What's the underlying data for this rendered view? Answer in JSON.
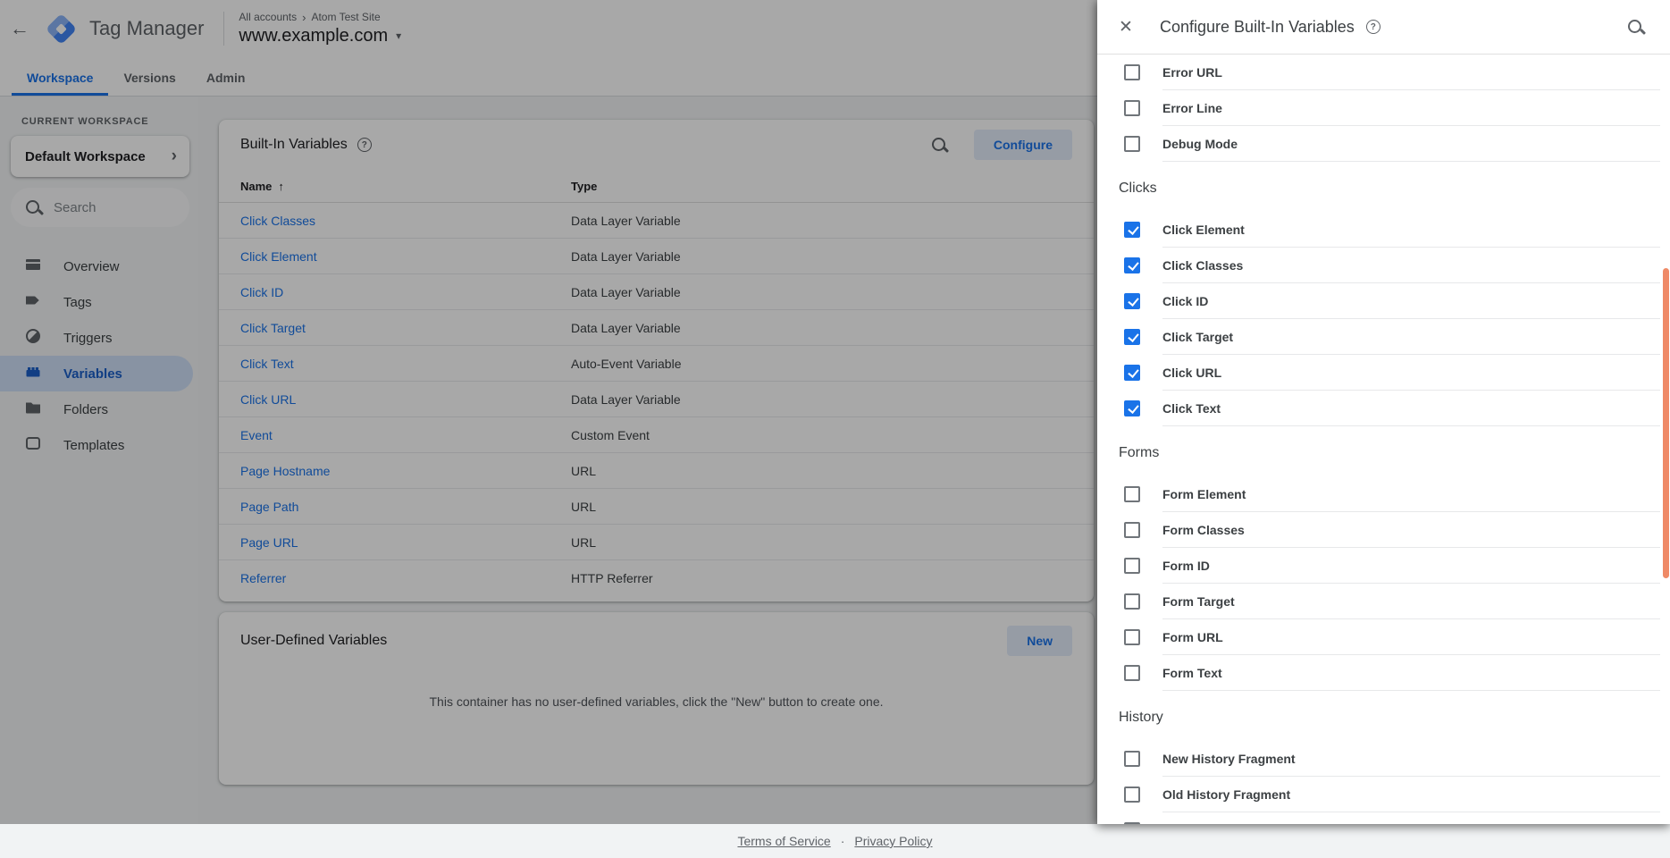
{
  "colors": {
    "accent_blue": "#1a73e8",
    "active_nav_bg": "#cfe0f7",
    "tonal_button_bg": "#e4edfb",
    "checked_checkbox": "#1a73e8",
    "scrollbar_thumb_orange": "#ef8a67",
    "content_bg": "#f1f3f4",
    "text_dark": "#202124",
    "text_gray": "#5f6368"
  },
  "icons": {
    "back_arrow": "←",
    "breadcrumb_separator": "›",
    "container_caret": "▾",
    "workspace_chevron": "›",
    "sort_arrow": "↑",
    "help_glyph": "?",
    "close_glyph": "✕",
    "footer_separator": "·"
  },
  "header": {
    "app_title": "Tag Manager",
    "breadcrumb": [
      "All accounts",
      "Atom Test Site"
    ],
    "container_name": "www.example.com",
    "tabs": [
      {
        "label": "Workspace",
        "active": true
      },
      {
        "label": "Versions",
        "active": false
      },
      {
        "label": "Admin",
        "active": false
      }
    ]
  },
  "sidebar": {
    "section_label": "CURRENT WORKSPACE",
    "workspace_name": "Default Workspace",
    "search_placeholder": "Search",
    "nav": [
      {
        "label": "Overview"
      },
      {
        "label": "Tags"
      },
      {
        "label": "Triggers"
      },
      {
        "label": "Variables"
      },
      {
        "label": "Folders"
      },
      {
        "label": "Templates"
      }
    ]
  },
  "builtin_card": {
    "title": "Built-In Variables",
    "configure_button": "Configure",
    "columns": {
      "name": "Name",
      "type": "Type"
    },
    "rows": [
      {
        "name": "Click Classes",
        "type": "Data Layer Variable"
      },
      {
        "name": "Click Element",
        "type": "Data Layer Variable"
      },
      {
        "name": "Click ID",
        "type": "Data Layer Variable"
      },
      {
        "name": "Click Target",
        "type": "Data Layer Variable"
      },
      {
        "name": "Click Text",
        "type": "Auto-Event Variable"
      },
      {
        "name": "Click URL",
        "type": "Data Layer Variable"
      },
      {
        "name": "Event",
        "type": "Custom Event"
      },
      {
        "name": "Page Hostname",
        "type": "URL"
      },
      {
        "name": "Page Path",
        "type": "URL"
      },
      {
        "name": "Page URL",
        "type": "URL"
      },
      {
        "name": "Referrer",
        "type": "HTTP Referrer"
      }
    ]
  },
  "user_defined_card": {
    "title": "User-Defined Variables",
    "new_button": "New",
    "empty_message": "This container has no user-defined variables, click the \"New\" button to create one."
  },
  "footer": {
    "links": [
      "Terms of Service",
      "Privacy Policy"
    ]
  },
  "panel": {
    "title": "Configure Built-In Variables",
    "sections": [
      {
        "heading": "",
        "items": [
          {
            "label": "Error URL",
            "checked": false
          },
          {
            "label": "Error Line",
            "checked": false
          },
          {
            "label": "Debug Mode",
            "checked": false
          }
        ]
      },
      {
        "heading": "Clicks",
        "items": [
          {
            "label": "Click Element",
            "checked": true
          },
          {
            "label": "Click Classes",
            "checked": true
          },
          {
            "label": "Click ID",
            "checked": true
          },
          {
            "label": "Click Target",
            "checked": true
          },
          {
            "label": "Click URL",
            "checked": true
          },
          {
            "label": "Click Text",
            "checked": true
          }
        ]
      },
      {
        "heading": "Forms",
        "items": [
          {
            "label": "Form Element",
            "checked": false
          },
          {
            "label": "Form Classes",
            "checked": false
          },
          {
            "label": "Form ID",
            "checked": false
          },
          {
            "label": "Form Target",
            "checked": false
          },
          {
            "label": "Form URL",
            "checked": false
          },
          {
            "label": "Form Text",
            "checked": false
          }
        ]
      },
      {
        "heading": "History",
        "items": [
          {
            "label": "New History Fragment",
            "checked": false
          },
          {
            "label": "Old History Fragment",
            "checked": false
          },
          {
            "label": "",
            "checked": false
          }
        ]
      }
    ]
  }
}
